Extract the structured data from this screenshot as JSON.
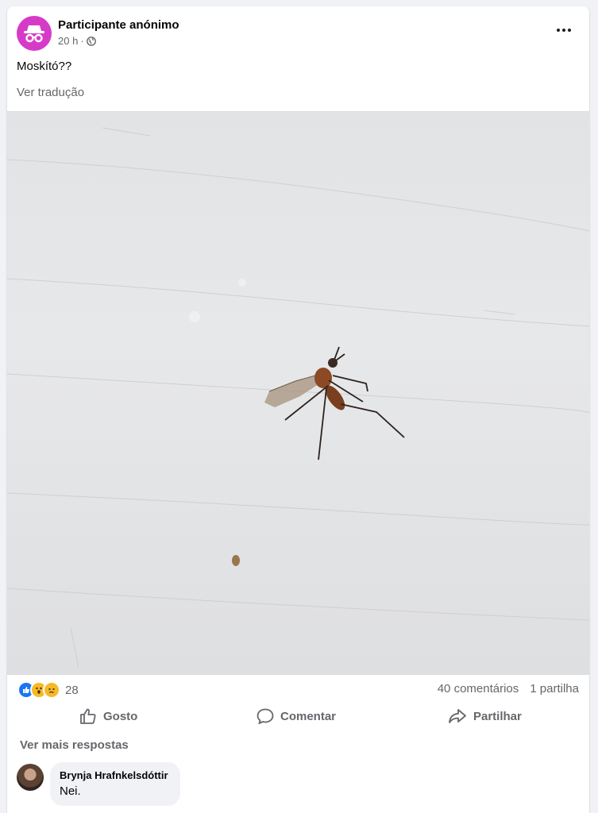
{
  "post": {
    "author": "Participante anónimo",
    "time": "20 h",
    "separator": "·",
    "text": "Moskító??",
    "translate_label": "Ver tradução",
    "more_icon": "more-horizontal-icon",
    "visibility_icon": "globe-icon"
  },
  "stats": {
    "reaction_icons": [
      "like-icon",
      "wow-icon",
      "sad-icon"
    ],
    "reaction_count": "28",
    "comments": "40 comentários",
    "shares": "1 partilha"
  },
  "actions": {
    "like": "Gosto",
    "comment": "Comentar",
    "share": "Partilhar"
  },
  "comments": {
    "more_replies": "Ver mais respostas",
    "items": [
      {
        "author": "Brynja Hrafnkelsdóttir",
        "text": "Nei."
      }
    ]
  },
  "colors": {
    "avatar": "#d63bc8",
    "like": "#1877f2",
    "emoji": "#f7b928",
    "secondary_text": "#65676b"
  }
}
